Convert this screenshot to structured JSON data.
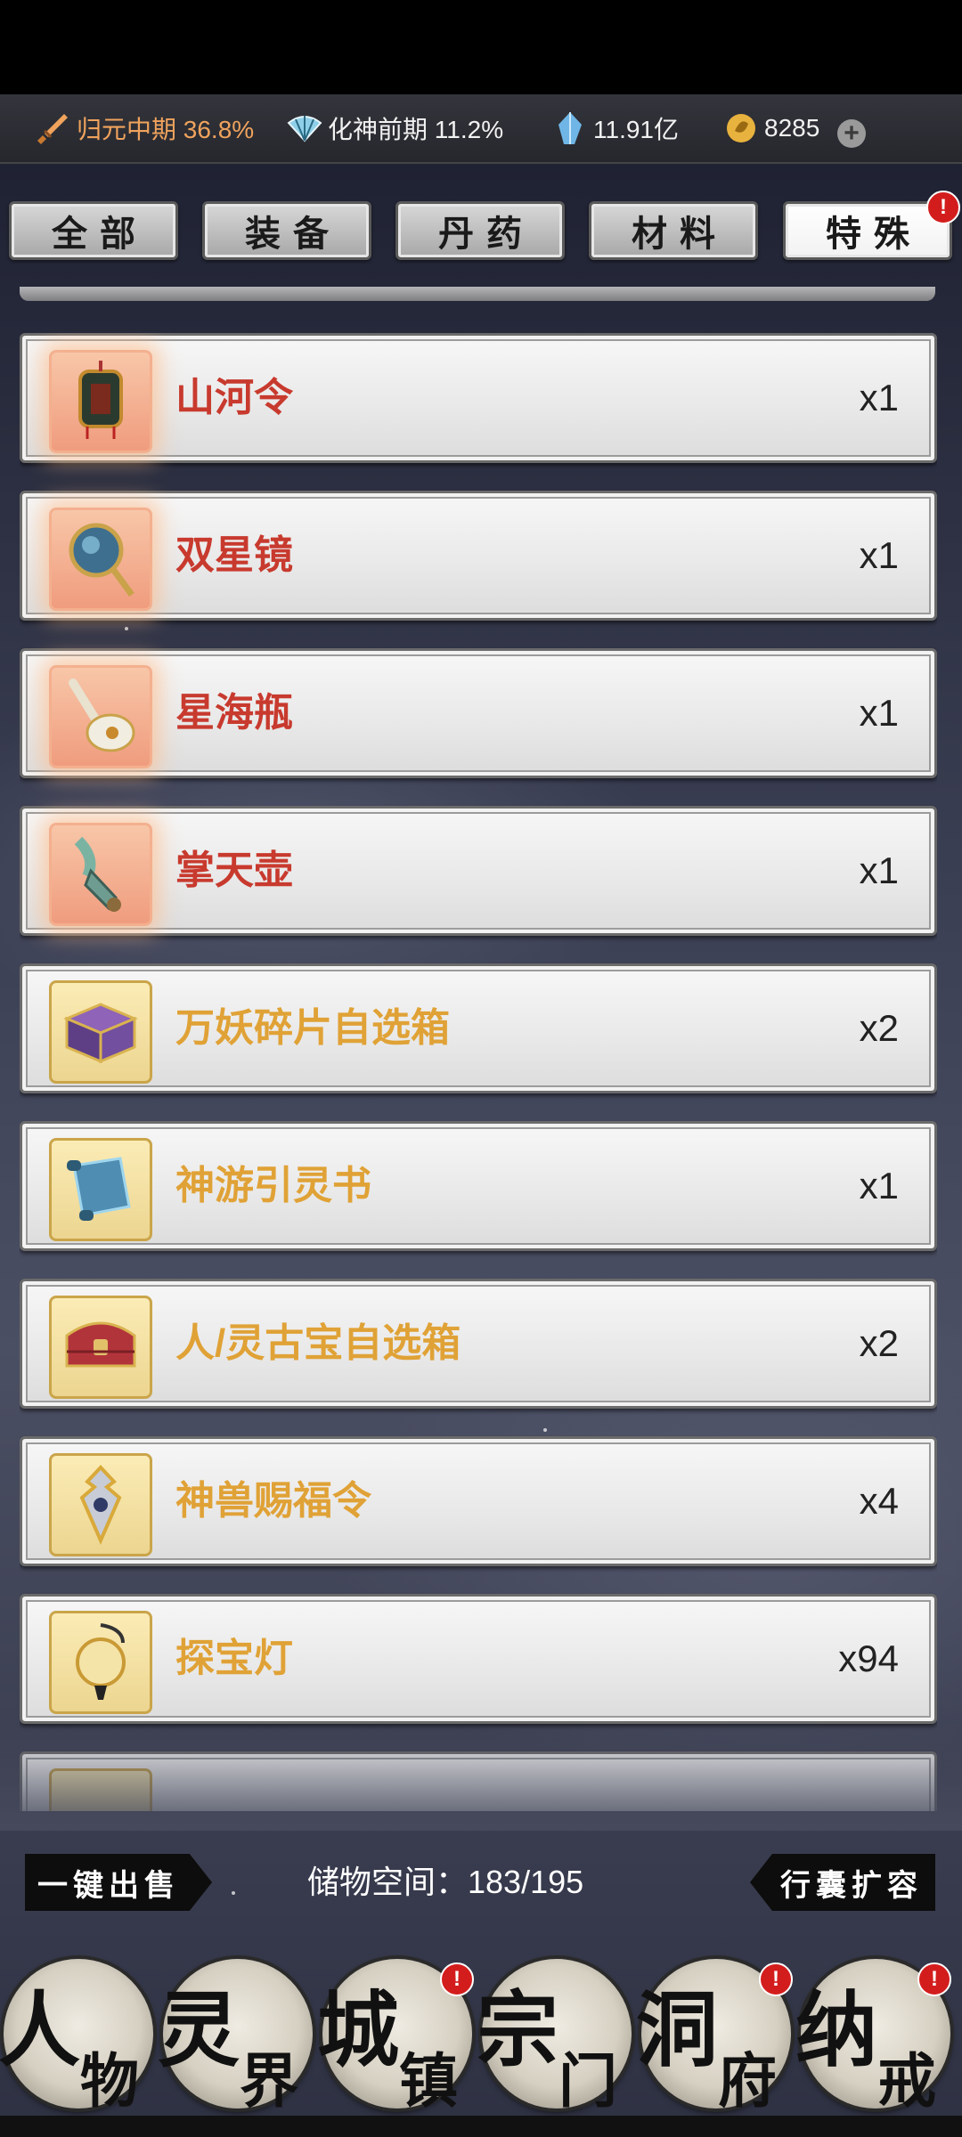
{
  "status": {
    "realm1": {
      "icon": "sword-icon",
      "label": "归元中期 36.8%"
    },
    "realm2": {
      "icon": "fan-icon",
      "label": "化神前期 11.2%"
    },
    "spirit_stones": {
      "icon": "crystal-icon",
      "label": "11.91亿"
    },
    "currency": {
      "icon": "coin-icon",
      "label": "8285"
    },
    "add_symbol": "+"
  },
  "tabs": [
    {
      "label": "全部",
      "active": false
    },
    {
      "label": "装备",
      "active": false
    },
    {
      "label": "丹药",
      "active": false
    },
    {
      "label": "材料",
      "active": false
    },
    {
      "label": "特殊",
      "active": true,
      "badge": "!"
    }
  ],
  "items": [
    {
      "name": "山河令",
      "qty": "x1",
      "rarity": "red",
      "icon": "token-lantern-icon"
    },
    {
      "name": "双星镜",
      "qty": "x1",
      "rarity": "red",
      "icon": "mirror-icon"
    },
    {
      "name": "星海瓶",
      "qty": "x1",
      "rarity": "red",
      "icon": "vase-icon"
    },
    {
      "name": "掌天壶",
      "qty": "x1",
      "rarity": "red",
      "icon": "pot-icon"
    },
    {
      "name": "万妖碎片自选箱",
      "qty": "x2",
      "rarity": "gold",
      "icon": "chest-icon"
    },
    {
      "name": "神游引灵书",
      "qty": "x1",
      "rarity": "gold",
      "icon": "scroll-icon"
    },
    {
      "name": "人/灵古宝自选箱",
      "qty": "x2",
      "rarity": "gold",
      "icon": "red-chest-icon"
    },
    {
      "name": "神兽赐福令",
      "qty": "x4",
      "rarity": "gold",
      "icon": "beast-token-icon"
    },
    {
      "name": "探宝灯",
      "qty": "x94",
      "rarity": "gold",
      "icon": "lamp-icon"
    }
  ],
  "footer": {
    "sell_button": "一键出售",
    "storage_label": "储物空间：183/195",
    "expand_button": "行囊扩容"
  },
  "nav": [
    {
      "c1": "人",
      "c2": "物",
      "badge": false
    },
    {
      "c1": "灵",
      "c2": "界",
      "badge": false
    },
    {
      "c1": "城",
      "c2": "镇",
      "badge": true
    },
    {
      "c1": "宗",
      "c2": "门",
      "badge": false
    },
    {
      "c1": "洞",
      "c2": "府",
      "badge": true
    },
    {
      "c1": "纳",
      "c2": "戒",
      "badge": true
    }
  ],
  "badge_symbol": "!",
  "colors": {
    "red_item": "#c83a2e",
    "gold_item": "#e0a236",
    "realm_orange": "#f0a35d",
    "badge": "#d31d1d"
  }
}
